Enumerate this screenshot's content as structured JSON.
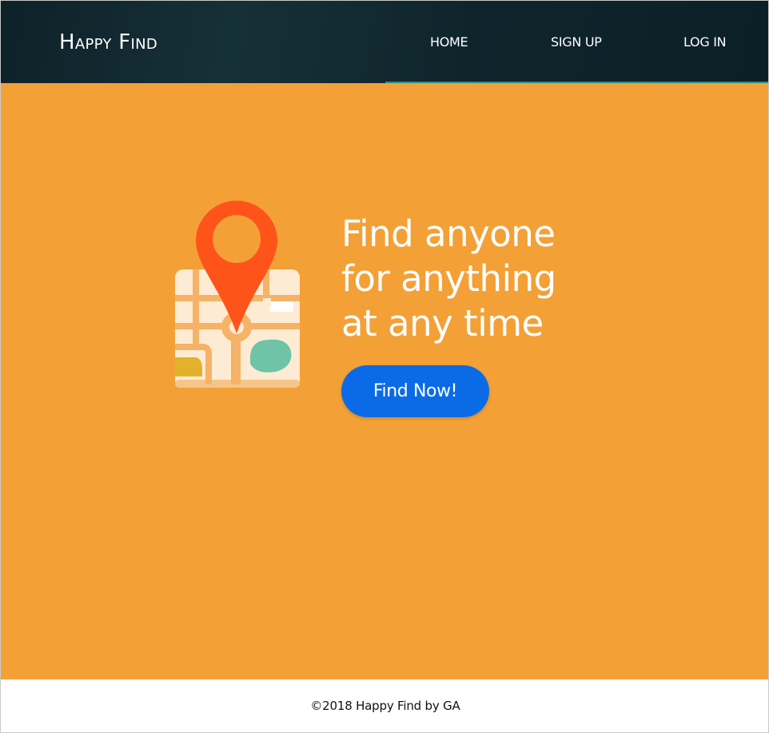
{
  "header": {
    "brand": "Happy Find",
    "nav": {
      "home": "HOME",
      "signup": "SIGN UP",
      "login": "LOG IN"
    }
  },
  "hero": {
    "headline_lines": [
      "Find anyone",
      "for anything",
      "at any time"
    ],
    "cta_label": "Find Now!",
    "illustration": "map-pin-icon"
  },
  "footer": {
    "text": "©2018 Happy Find by GA"
  },
  "colors": {
    "header_bg": "#0f252c",
    "hero_bg": "#f3a037",
    "cta_bg": "#0b6be6",
    "pin": "#ff5419",
    "map_bg": "#fdebd3",
    "map_road": "#f6b267",
    "map_park": "#6fc3a6",
    "map_field": "#e3b22c",
    "nav_underline": "#2c8a8a"
  }
}
